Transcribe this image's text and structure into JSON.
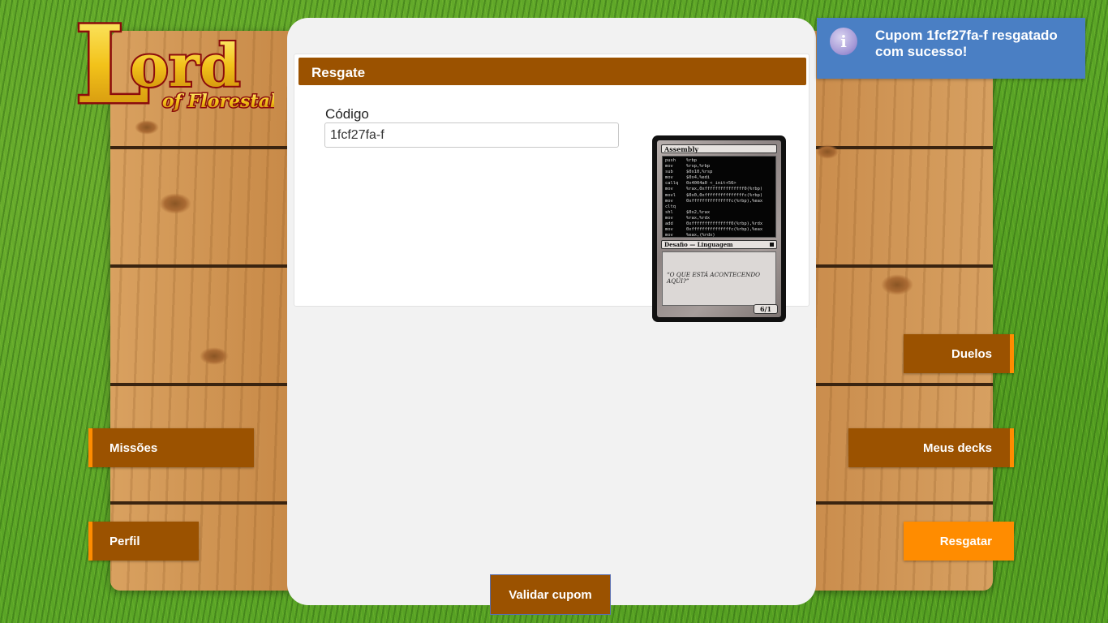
{
  "logo": {
    "line1": "Lord",
    "line2": "of Florestal"
  },
  "panel": {
    "header": "Resgate",
    "code_label": "Código",
    "code_value": "1fcf27fa-f"
  },
  "game_card": {
    "title": "Assembly",
    "code_lines": [
      "push    %rbp",
      "mov     %rsp,%rbp",
      "sub     $0x10,%rsp",
      "mov     $0x4,%edi",
      "callq   0x4004a0 <_init+56>",
      "mov     %rax,0xfffffffffffffff0(%rbp)",
      "movl    $0x0,0xfffffffffffffffc(%rbp)",
      "mov     0xfffffffffffffffc(%rbp),%eax",
      "cltq",
      "shl     $0x2,%rax",
      "mov     %rax,%rdx",
      "add     0xfffffffffffffff0(%rbp),%rdx",
      "mov     0xfffffffffffffffc(%rbp),%eax",
      "mov     %eax,(%rdx)"
    ],
    "type_line": "Desafio — Linguagem",
    "flavor_text": "“O QUE ESTÁ ACONTECENDO AQUI?”",
    "power_toughness": "6/1"
  },
  "buttons": {
    "duelos": "Duelos",
    "missoes": "Missões",
    "meus_decks": "Meus decks",
    "perfil": "Perfil",
    "resgatar": "Resgatar",
    "validar": "Validar cupom"
  },
  "toast": {
    "icon": "info-icon",
    "icon_glyph": "i",
    "message": "Cupom 1fcf27fa-f resgatado com sucesso!"
  },
  "colors": {
    "brown": "#9b5200",
    "orange": "#ff8c00",
    "toast_blue": "#4a7fc4"
  }
}
